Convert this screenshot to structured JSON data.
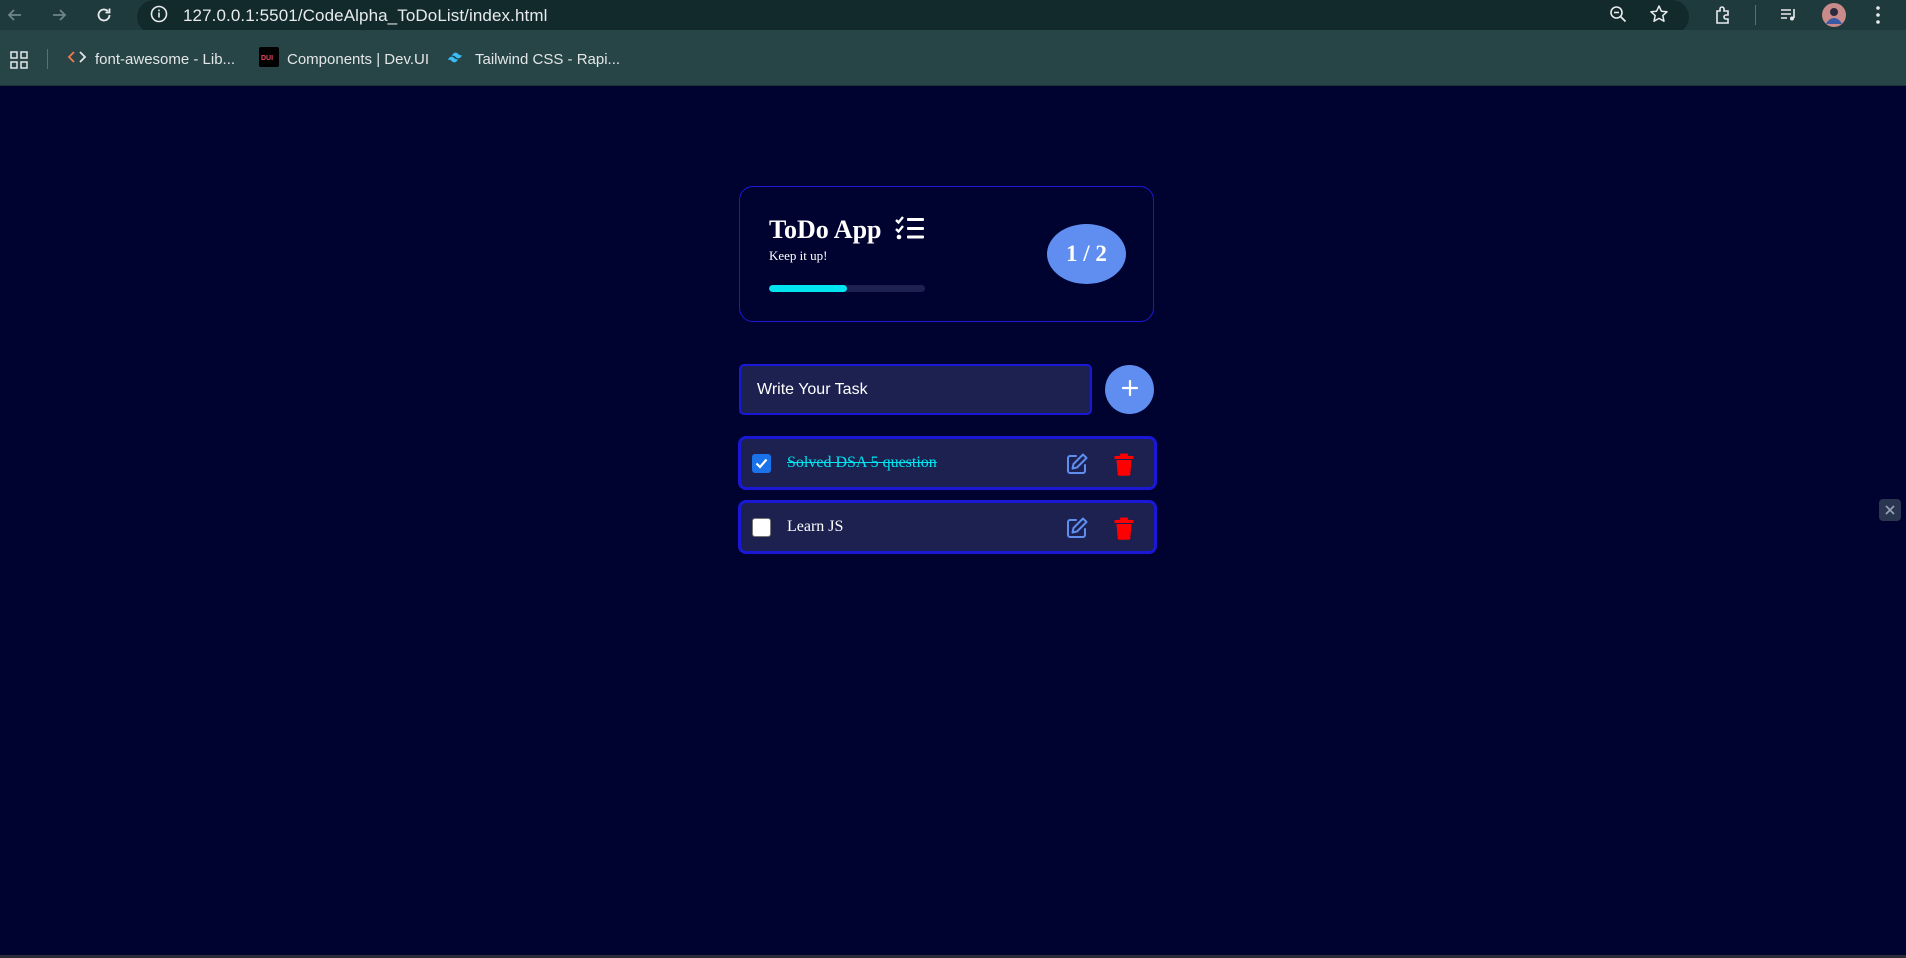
{
  "browser": {
    "url": "127.0.0.1:5501/CodeAlpha_ToDoList/index.html",
    "bookmarks": [
      {
        "label": "font-awesome - Lib...",
        "icon": "code-brackets-icon"
      },
      {
        "label": "Components | Dev.UI",
        "icon": "dui-logo-icon"
      },
      {
        "label": "Tailwind CSS - Rapi...",
        "icon": "tailwind-logo-icon"
      }
    ]
  },
  "app": {
    "title": "ToDo App",
    "subtitle": "Keep it up!",
    "progress_fraction": 0.5,
    "counter": "1 / 2",
    "input_placeholder": "Write Your Task",
    "add_icon": "plus-icon",
    "tasks": [
      {
        "text": "Solved DSA 5 question",
        "completed": true
      },
      {
        "text": "Learn JS",
        "completed": false
      }
    ]
  },
  "colors": {
    "background": "#000330",
    "border": "#1a18d6",
    "accent": "#5f8ef0",
    "progress": "#00e5f0",
    "completed_text": "#00e5f0",
    "delete": "#ff0000",
    "edit": "#5f8ef0"
  }
}
